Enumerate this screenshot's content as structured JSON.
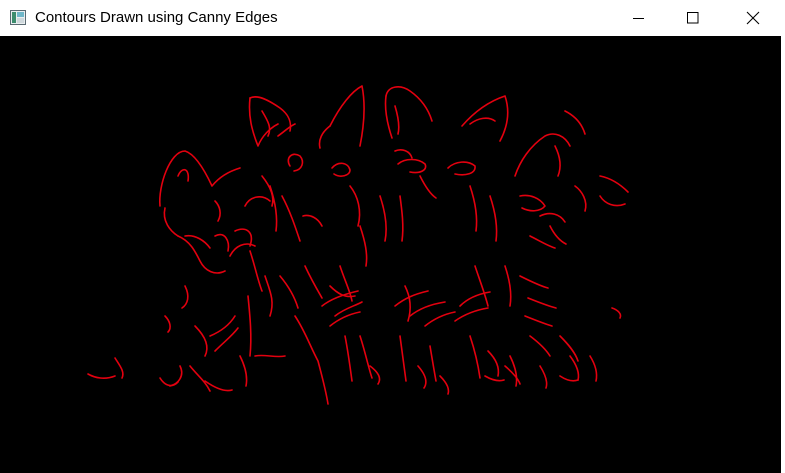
{
  "window": {
    "title": "Contours Drawn using Canny Edges",
    "icon": "app-window-icon"
  },
  "controls": {
    "minimize_icon": "minimize-icon",
    "maximize_icon": "maximize-icon",
    "close_icon": "close-icon"
  },
  "colors": {
    "titlebar_bg": "#ffffff",
    "canvas_bg": "#000000",
    "contour": "#e3000f"
  }
}
